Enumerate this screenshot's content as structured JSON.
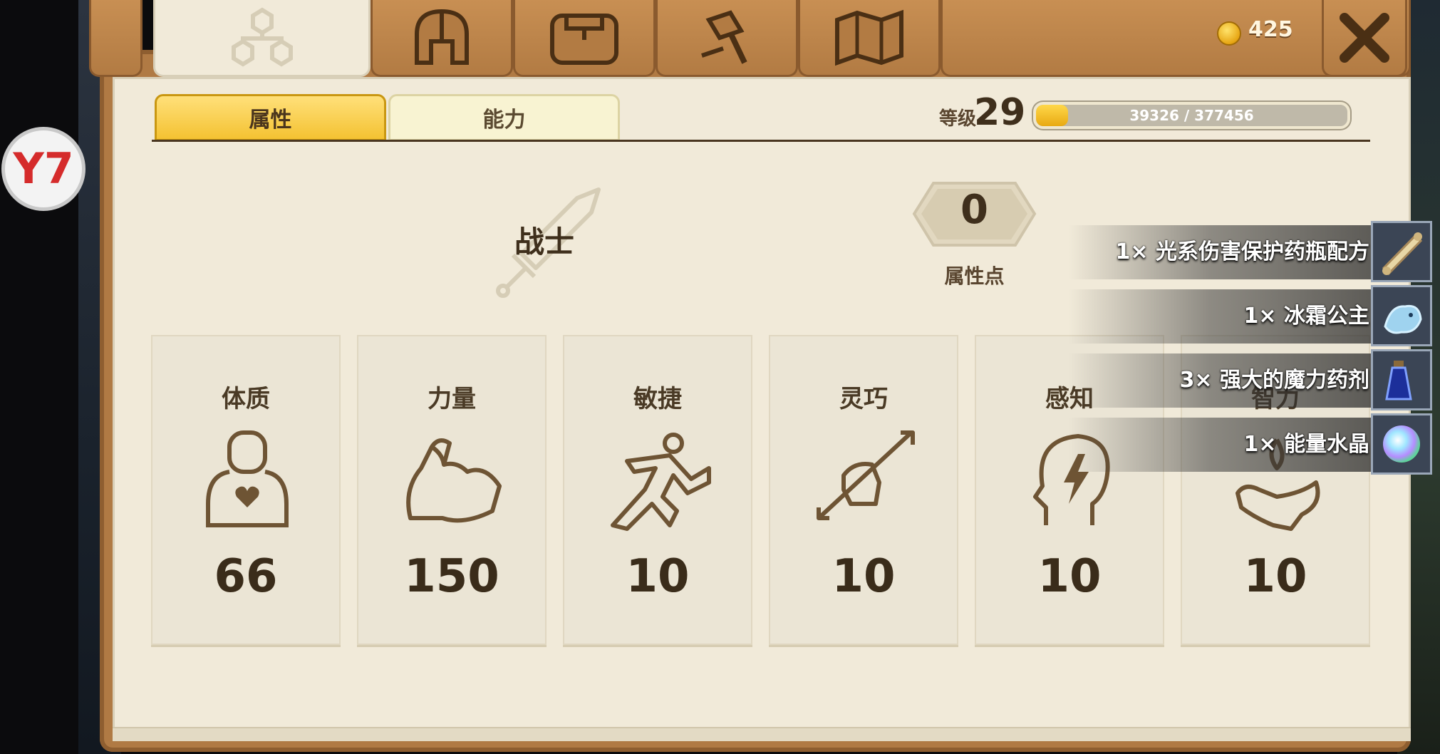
{
  "logo": {
    "text": "Y7"
  },
  "top_tabs": [
    {
      "name": "skills-tree",
      "icon": "skill-tree-icon",
      "active": true
    },
    {
      "name": "equipment",
      "icon": "helmet-icon",
      "active": false
    },
    {
      "name": "inventory",
      "icon": "bag-icon",
      "active": false
    },
    {
      "name": "crafting",
      "icon": "hammer-icon",
      "active": false
    },
    {
      "name": "map",
      "icon": "map-icon",
      "active": false
    }
  ],
  "currency": {
    "icon": "gold-coin-icon",
    "amount": "425"
  },
  "close": {
    "icon": "close-icon"
  },
  "sub_tabs": {
    "attributes": "属性",
    "abilities": "能力"
  },
  "level": {
    "label": "等级",
    "value": "29",
    "xp_text": "39326 / 377456",
    "xp_fraction": 0.104
  },
  "class": {
    "name": "战士",
    "icon": "sword-icon"
  },
  "attribute_points": {
    "value": "0",
    "label": "属性点"
  },
  "stats": [
    {
      "label": "体质",
      "value": "66",
      "icon": "constitution-icon"
    },
    {
      "label": "力量",
      "value": "150",
      "icon": "strength-icon"
    },
    {
      "label": "敏捷",
      "value": "10",
      "icon": "agility-icon"
    },
    {
      "label": "灵巧",
      "value": "10",
      "icon": "dexterity-icon"
    },
    {
      "label": "感知",
      "value": "10",
      "icon": "perception-icon"
    },
    {
      "label": "智力",
      "value": "10",
      "icon": "intelligence-icon"
    }
  ],
  "loot": [
    {
      "text": "1×  光系伤害保护药瓶配方",
      "icon": "scroll-icon"
    },
    {
      "text": "1×  冰霜公主",
      "icon": "ice-creature-icon"
    },
    {
      "text": "3×  强大的魔力药剂",
      "icon": "potion-icon"
    },
    {
      "text": "1×  能量水晶",
      "icon": "crystal-icon"
    }
  ],
  "colors": {
    "wood": "#b07a44",
    "paper": "#f1ead9",
    "accent": "#f4c232",
    "ink": "#3f2f1c"
  }
}
